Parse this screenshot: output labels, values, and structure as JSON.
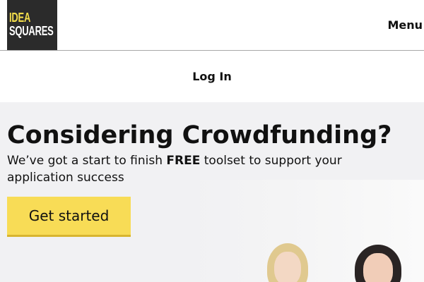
{
  "header": {
    "logo": {
      "line1": "IDEA",
      "line2": "SQUARES"
    },
    "menu_label": "Menu"
  },
  "auth": {
    "login_label": "Log In"
  },
  "hero": {
    "headline": "Considering Crowdfunding?",
    "subtext_before": "We’ve got a start to finish ",
    "subtext_bold": "FREE",
    "subtext_after": " toolset to support your application success",
    "cta_label": "Get started"
  },
  "colors": {
    "accent": "#f8dc56",
    "logo_bg": "#2b2b2b",
    "hero_bg": "#f1f1f3"
  }
}
